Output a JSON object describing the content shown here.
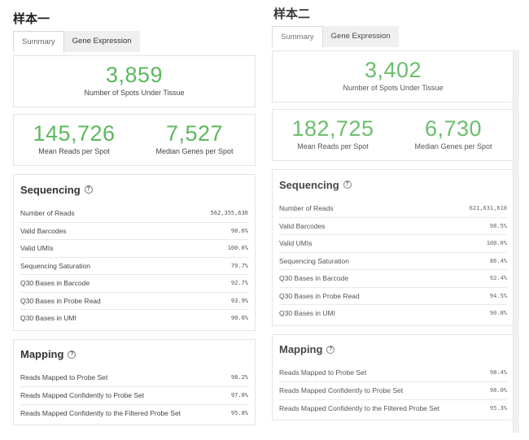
{
  "panels": [
    {
      "title": "样本一",
      "tabs": [
        "Summary",
        "Gene Expression"
      ],
      "spots": {
        "value": "3,859",
        "label": "Number of Spots Under Tissue"
      },
      "reads_genes": [
        {
          "value": "145,726",
          "label": "Mean Reads per Spot"
        },
        {
          "value": "7,527",
          "label": "Median Genes per Spot"
        }
      ],
      "sequencing": {
        "title": "Sequencing",
        "rows": [
          {
            "label": "Number of Reads",
            "value": "562,355,636"
          },
          {
            "label": "Valid Barcodes",
            "value": "98.6%"
          },
          {
            "label": "Valid UMIs",
            "value": "100.0%"
          },
          {
            "label": "Sequencing Saturation",
            "value": "79.7%"
          },
          {
            "label": "Q30 Bases in Barcode",
            "value": "92.7%"
          },
          {
            "label": "Q30 Bases in Probe Read",
            "value": "93.9%"
          },
          {
            "label": "Q30 Bases in UMI",
            "value": "90.6%"
          }
        ]
      },
      "mapping": {
        "title": "Mapping",
        "rows": [
          {
            "label": "Reads Mapped to Probe Set",
            "value": "98.2%"
          },
          {
            "label": "Reads Mapped Confidently to Probe Set",
            "value": "97.8%"
          },
          {
            "label": "Reads Mapped Confidently to the Filtered Probe Set",
            "value": "95.8%"
          }
        ]
      }
    },
    {
      "title": "样本二",
      "tabs": [
        "Summary",
        "Gene Expression"
      ],
      "spots": {
        "value": "3,402",
        "label": "Number of Spots Under Tissue"
      },
      "reads_genes": [
        {
          "value": "182,725",
          "label": "Mean Reads per Spot"
        },
        {
          "value": "6,730",
          "label": "Median Genes per Spot"
        }
      ],
      "sequencing": {
        "title": "Sequencing",
        "rows": [
          {
            "label": "Number of Reads",
            "value": "621,631,610"
          },
          {
            "label": "Valid Barcodes",
            "value": "98.5%"
          },
          {
            "label": "Valid UMIs",
            "value": "100.0%"
          },
          {
            "label": "Sequencing Saturation",
            "value": "86.4%"
          },
          {
            "label": "Q30 Bases in Barcode",
            "value": "92.4%"
          },
          {
            "label": "Q30 Bases in Probe Read",
            "value": "94.5%"
          },
          {
            "label": "Q30 Bases in UMI",
            "value": "90.8%"
          }
        ]
      },
      "mapping": {
        "title": "Mapping",
        "rows": [
          {
            "label": "Reads Mapped to Probe Set",
            "value": "98.4%"
          },
          {
            "label": "Reads Mapped Confidently to Probe Set",
            "value": "98.0%"
          },
          {
            "label": "Reads Mapped Confidently to the Filtered Probe Set",
            "value": "95.3%"
          }
        ]
      }
    }
  ],
  "colors": {
    "metric_green": "#5cb85c",
    "border": "#e3e3e3",
    "tab_inactive": "#efefef"
  },
  "icons": {
    "help": "question-circle-icon"
  }
}
